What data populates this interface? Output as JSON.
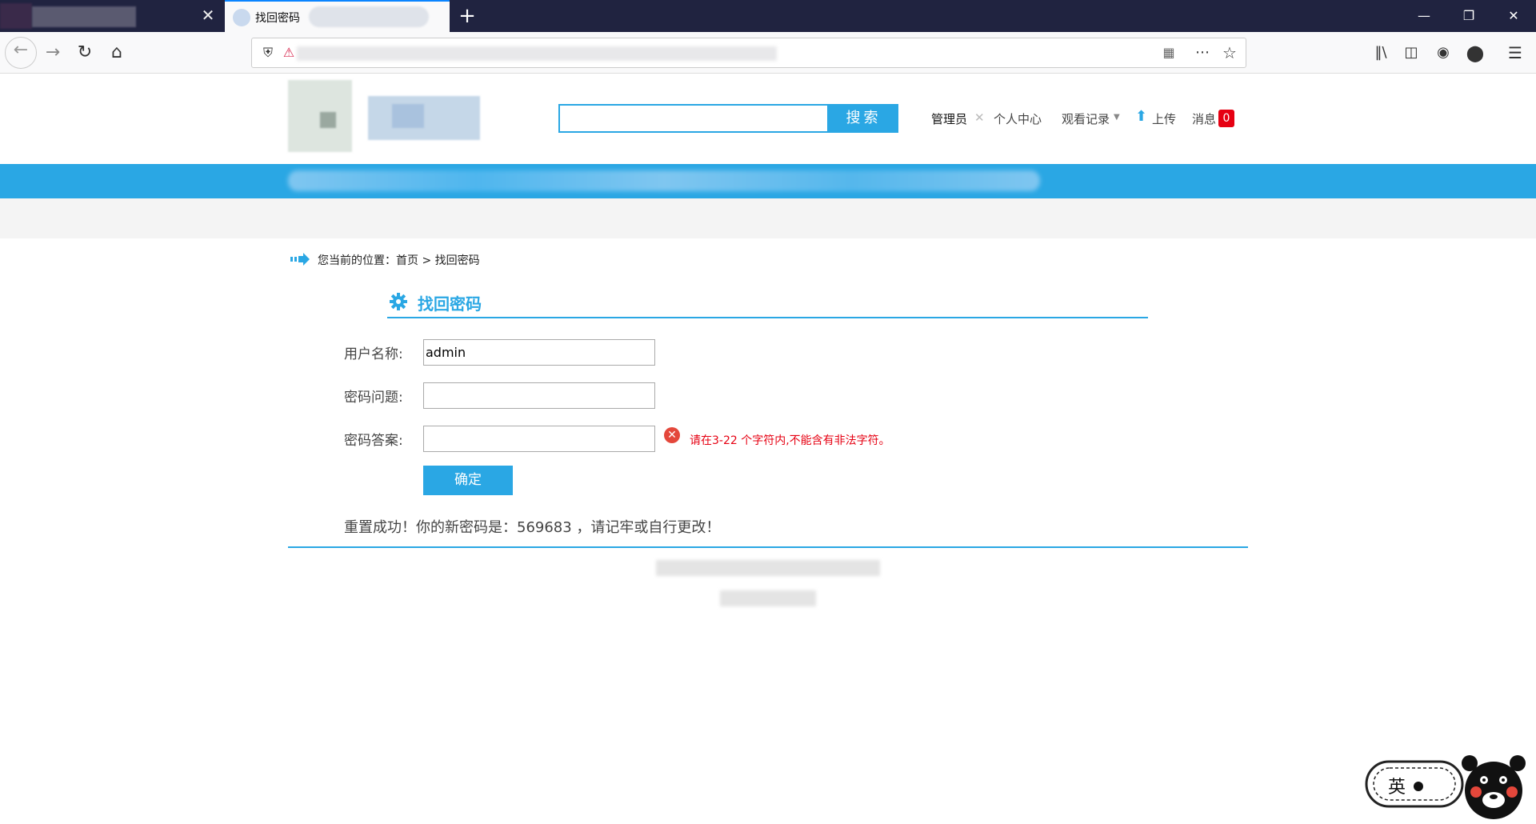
{
  "browser": {
    "active_tab_title": "找回密码",
    "new_tab_label": "+",
    "close_tab_glyph": "✕"
  },
  "header": {
    "search_button": "搜索",
    "search_placeholder": "",
    "links": {
      "admin": "管理员",
      "personal_center": "个人中心",
      "history": "观看记录",
      "upload": "上传",
      "messages": "消息",
      "message_count": "0"
    }
  },
  "breadcrumb": {
    "prefix": "您当前的位置：",
    "home": "首页",
    "separator": ">",
    "current": "找回密码"
  },
  "form": {
    "title": "找回密码",
    "username_label": "用户名称:",
    "username_value": "admin",
    "question_label": "密码问题:",
    "question_value": "",
    "answer_label": "密码答案:",
    "answer_value": "",
    "error_text": "请在3-22 个字符内,不能含有非法字符。",
    "submit_label": "确定",
    "success_message": "重置成功！你的新密码是：569683 ，请记牢或自行更改！"
  },
  "mascot": {
    "text": "英"
  },
  "colors": {
    "accent": "#2aa7e4",
    "error": "#e60012",
    "tabbar": "#202340"
  }
}
